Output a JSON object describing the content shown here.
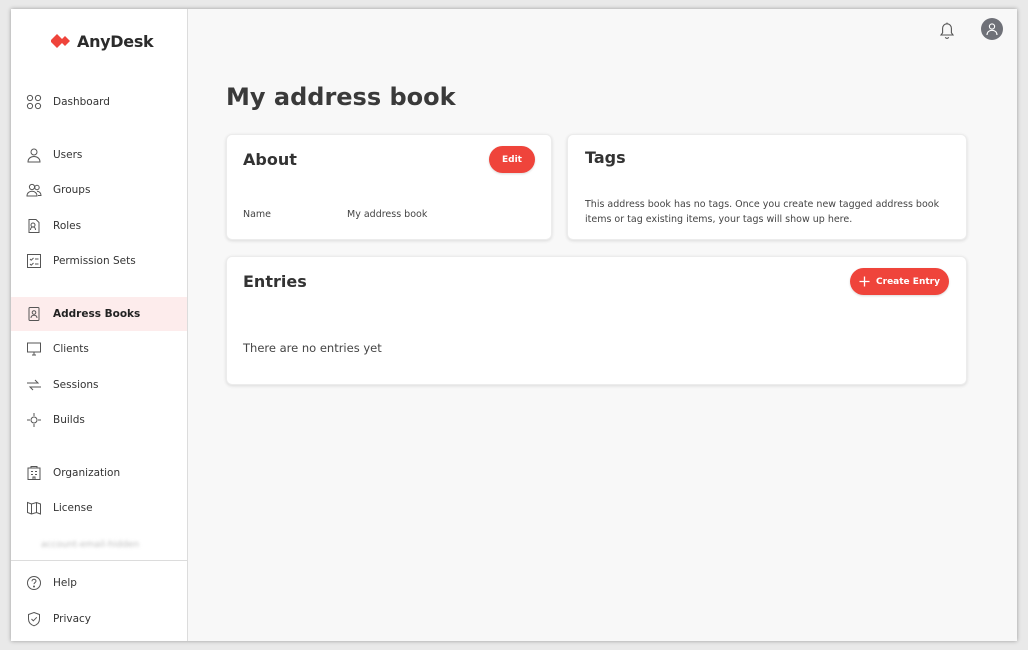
{
  "app": {
    "brand": "AnyDesk",
    "brand_color": "#ef443b"
  },
  "sidebar": {
    "items": [
      {
        "label": "Dashboard",
        "icon": "dashboard-icon"
      },
      {
        "label": "Users",
        "icon": "user-icon"
      },
      {
        "label": "Groups",
        "icon": "groups-icon"
      },
      {
        "label": "Roles",
        "icon": "roles-icon"
      },
      {
        "label": "Permission Sets",
        "icon": "permission-sets-icon"
      },
      {
        "label": "Address Books",
        "icon": "address-book-icon",
        "active": true
      },
      {
        "label": "Clients",
        "icon": "monitor-icon"
      },
      {
        "label": "Sessions",
        "icon": "sessions-icon"
      },
      {
        "label": "Builds",
        "icon": "builds-icon"
      },
      {
        "label": "Organization",
        "icon": "organization-icon"
      },
      {
        "label": "License",
        "icon": "license-icon"
      },
      {
        "label": "Help",
        "icon": "help-icon"
      },
      {
        "label": "Privacy",
        "icon": "privacy-shield-icon"
      }
    ],
    "blurred_text": "account-email-hidden"
  },
  "topbar": {
    "bell_icon": "bell-icon",
    "avatar_icon": "user-avatar-icon"
  },
  "main": {
    "title": "My address book",
    "about": {
      "title": "About",
      "edit_label": "Edit",
      "name_label": "Name",
      "name_value": "My address book"
    },
    "tags": {
      "title": "Tags",
      "description": "This address book has no tags. Once you create new tagged address book items or tag existing items, your tags will show up here."
    },
    "entries": {
      "title": "Entries",
      "create_label": "Create Entry",
      "empty_text": "There are no entries yet"
    }
  }
}
